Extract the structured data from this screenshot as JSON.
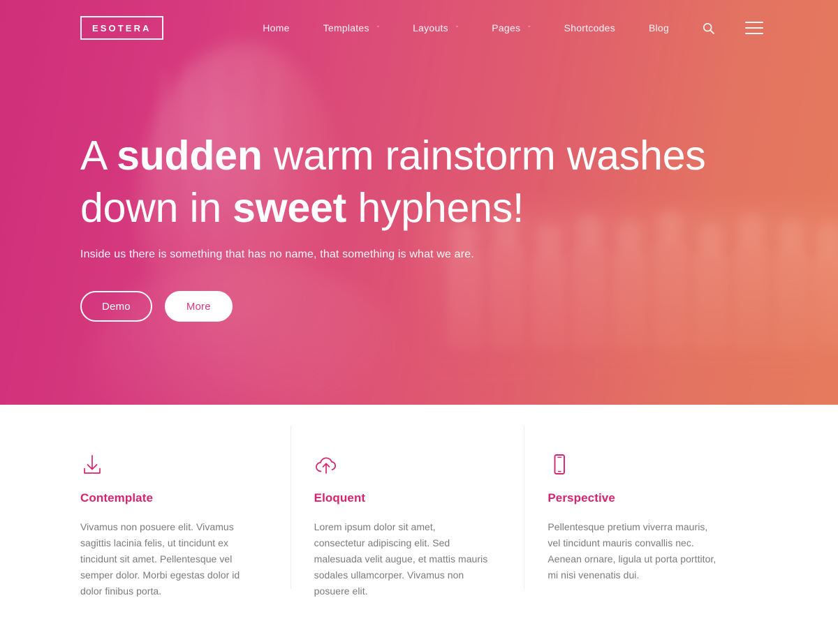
{
  "colors": {
    "gradient_start": "#cf2e79",
    "gradient_end": "#e57b5d",
    "accent_pink": "#d6246e",
    "button_text_pink": "#d93880",
    "body_text": "#7b7b7b",
    "divider": "#eeeeee",
    "section_bg": "#ffffff"
  },
  "navbar": {
    "logo": "ESOTERA",
    "items": [
      {
        "label": "Home",
        "has_dropdown": false
      },
      {
        "label": "Templates",
        "has_dropdown": true
      },
      {
        "label": "Layouts",
        "has_dropdown": true
      },
      {
        "label": "Pages",
        "has_dropdown": true
      },
      {
        "label": "Shortcodes",
        "has_dropdown": false
      },
      {
        "label": "Blog",
        "has_dropdown": false
      }
    ],
    "caret": "ˇ",
    "search_icon": "search-icon",
    "menu_icon": "hamburger-icon"
  },
  "hero": {
    "headline_line1_pre": "A ",
    "headline_line1_bold": "sudden",
    "headline_line1_post": " warm rainstorm washes",
    "headline_line2_pre": "down in ",
    "headline_line2_bold": "sweet",
    "headline_line2_post": " hyphens!",
    "subtitle": "Inside us there is something that has no name, that something is what we are.",
    "buttons": {
      "demo": "Demo",
      "more": "More"
    }
  },
  "features": [
    {
      "icon": "download-icon",
      "title": "Contemplate",
      "text": "Vivamus non posuere elit. Vivamus sagittis lacinia felis, ut tincidunt ex tincidunt sit amet. Pellentesque vel semper dolor. Morbi egestas dolor id dolor finibus porta."
    },
    {
      "icon": "cloud-upload-icon",
      "title": "Eloquent",
      "text": "Lorem ipsum dolor sit amet, consectetur adipiscing elit. Sed malesuada velit augue, et mattis mauris sodales ullamcorper. Vivamus non posuere elit."
    },
    {
      "icon": "mobile-icon",
      "title": "Perspective",
      "text": "Pellentesque pretium viverra mauris, vel tincidunt mauris convallis nec. Aenean ornare, ligula ut porta porttitor, mi nisi venenatis dui."
    }
  ]
}
